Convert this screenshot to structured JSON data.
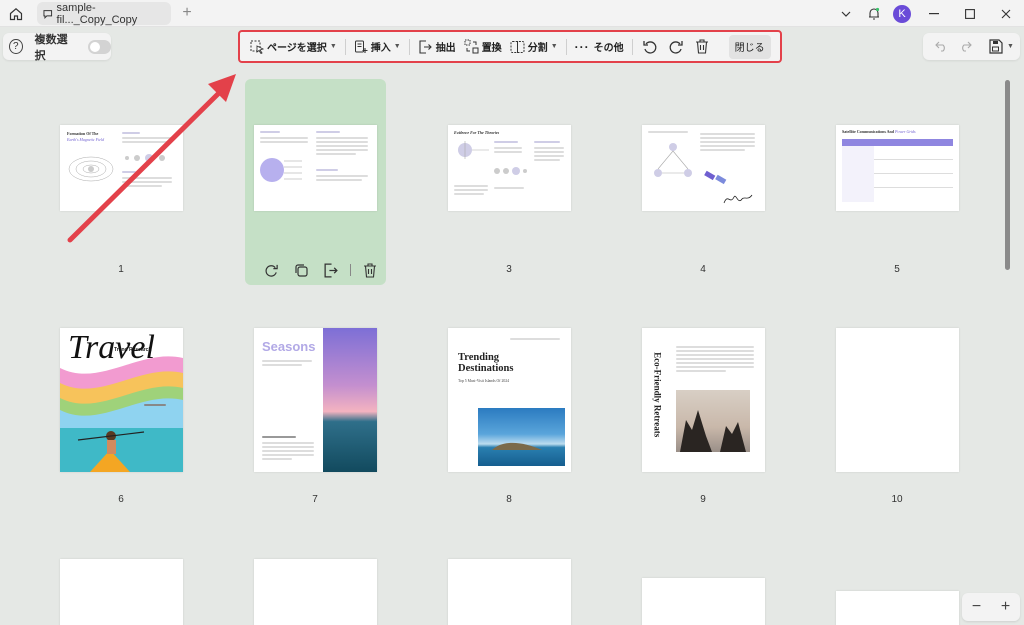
{
  "titlebar": {
    "tab_title": "sample-fil..._Copy_Copy",
    "avatar_letter": "K"
  },
  "multi_select": {
    "label": "複数選択"
  },
  "toolbar": {
    "select_pages": "ページを選択",
    "insert": "挿入",
    "extract": "抽出",
    "replace": "置換",
    "split": "分割",
    "more": "その他",
    "close": "閉じる"
  },
  "pages": [
    {
      "number": "1",
      "title": "Formation Of The",
      "subtitle": "Earth's Magnetic Field"
    },
    {
      "number": "2"
    },
    {
      "number": "3",
      "title": "Evidence For The Theories"
    },
    {
      "number": "4"
    },
    {
      "number": "5",
      "title": "Satellite Communications And",
      "title_italic": "Power Grids"
    },
    {
      "number": "6",
      "title": "Travel",
      "subtitle": "Trend Research"
    },
    {
      "number": "7",
      "title": "Seasons"
    },
    {
      "number": "8",
      "title": "Trending Destinations",
      "subtitle": "Top 5 Must-Visit Islands Of 2024"
    },
    {
      "number": "9",
      "title": "Eco-Friendly Retreats"
    },
    {
      "number": "10"
    }
  ],
  "colors": {
    "accent_red": "#e3414a",
    "selected_green": "#c5e0c6",
    "avatar": "#6a4bd8"
  }
}
